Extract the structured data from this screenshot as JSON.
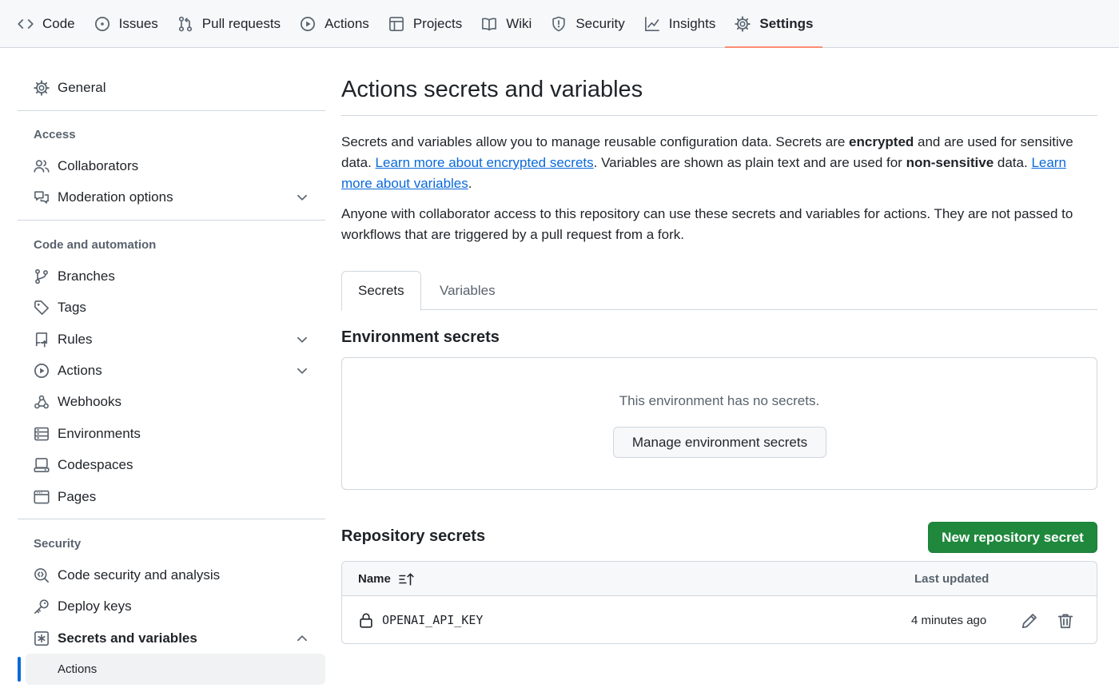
{
  "topnav": {
    "tabs": [
      {
        "label": "Code",
        "icon": "code-icon"
      },
      {
        "label": "Issues",
        "icon": "issue-opened-icon"
      },
      {
        "label": "Pull requests",
        "icon": "git-pull-request-icon"
      },
      {
        "label": "Actions",
        "icon": "play-icon"
      },
      {
        "label": "Projects",
        "icon": "table-icon"
      },
      {
        "label": "Wiki",
        "icon": "book-icon"
      },
      {
        "label": "Security",
        "icon": "shield-icon"
      },
      {
        "label": "Insights",
        "icon": "graph-icon"
      },
      {
        "label": "Settings",
        "icon": "gear-icon",
        "selected": true
      }
    ]
  },
  "sidebar": {
    "general": "General",
    "access_heading": "Access",
    "collaborators": "Collaborators",
    "moderation": "Moderation options",
    "code_heading": "Code and automation",
    "branches": "Branches",
    "tags": "Tags",
    "rules": "Rules",
    "actions": "Actions",
    "webhooks": "Webhooks",
    "environments": "Environments",
    "codespaces": "Codespaces",
    "pages": "Pages",
    "security_heading": "Security",
    "code_security": "Code security and analysis",
    "deploy_keys": "Deploy keys",
    "secrets_vars": "Secrets and variables",
    "secrets_actions": "Actions"
  },
  "main": {
    "title": "Actions secrets and variables",
    "para1": {
      "t1": "Secrets and variables allow you to manage reusable configuration data. Secrets are ",
      "b1": "encrypted",
      "t2": " and are used for sensitive data. ",
      "link1": "Learn more about encrypted secrets",
      "t3": ". Variables are shown as plain text and are used for ",
      "b2": "non-sensitive",
      "t4": " data. ",
      "link2": "Learn more about variables",
      "t5": "."
    },
    "para2": "Anyone with collaborator access to this repository can use these secrets and variables for actions. They are not passed to workflows that are triggered by a pull request from a fork.",
    "tabs": {
      "secrets": "Secrets",
      "variables": "Variables"
    },
    "env_title": "Environment secrets",
    "env_empty": "This environment has no secrets.",
    "env_button": "Manage environment secrets",
    "repo_title": "Repository secrets",
    "repo_button": "New repository secret",
    "table": {
      "col_name": "Name",
      "col_updated": "Last updated",
      "rows": [
        {
          "name": "OPENAI_API_KEY",
          "updated": "4 minutes ago"
        }
      ]
    }
  },
  "colors": {
    "accent": "#fd8c73",
    "link": "#0969da",
    "primary": "#1f883d"
  }
}
